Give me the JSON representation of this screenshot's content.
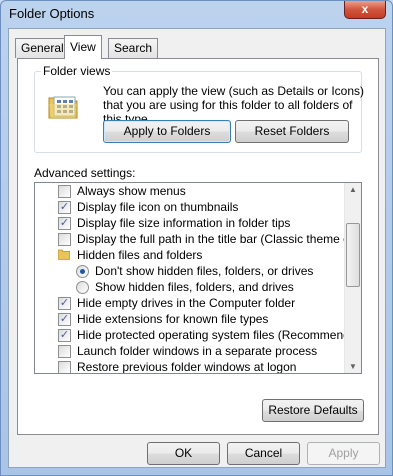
{
  "window": {
    "title": "Folder Options",
    "close_label": "x"
  },
  "tabs": [
    {
      "label": "General"
    },
    {
      "label": "View"
    },
    {
      "label": "Search"
    }
  ],
  "folder_views": {
    "label": "Folder views",
    "description": "You can apply the view (such as Details or Icons) that you are using for this folder to all folders of this type.",
    "apply_label": "Apply to Folders",
    "reset_label": "Reset Folders"
  },
  "advanced": {
    "label": "Advanced settings:",
    "items": [
      {
        "type": "checkbox",
        "checked": false,
        "label": "Always show menus"
      },
      {
        "type": "checkbox",
        "checked": true,
        "label": "Display file icon on thumbnails"
      },
      {
        "type": "checkbox",
        "checked": true,
        "label": "Display file size information in folder tips"
      },
      {
        "type": "checkbox",
        "checked": false,
        "label": "Display the full path in the title bar (Classic theme only)"
      },
      {
        "type": "folder",
        "label": "Hidden files and folders"
      },
      {
        "type": "radio",
        "checked": true,
        "label": "Don't show hidden files, folders, or drives"
      },
      {
        "type": "radio",
        "checked": false,
        "label": "Show hidden files, folders, and drives"
      },
      {
        "type": "checkbox",
        "checked": true,
        "label": "Hide empty drives in the Computer folder"
      },
      {
        "type": "checkbox",
        "checked": true,
        "label": "Hide extensions for known file types"
      },
      {
        "type": "checkbox",
        "checked": true,
        "label": "Hide protected operating system files (Recommended)"
      },
      {
        "type": "checkbox",
        "checked": false,
        "label": "Launch folder windows in a separate process"
      },
      {
        "type": "checkbox",
        "checked": false,
        "label": "Restore previous folder windows at logon"
      }
    ],
    "restore_label": "Restore Defaults"
  },
  "footer": {
    "ok_label": "OK",
    "cancel_label": "Cancel",
    "apply_label": "Apply"
  }
}
